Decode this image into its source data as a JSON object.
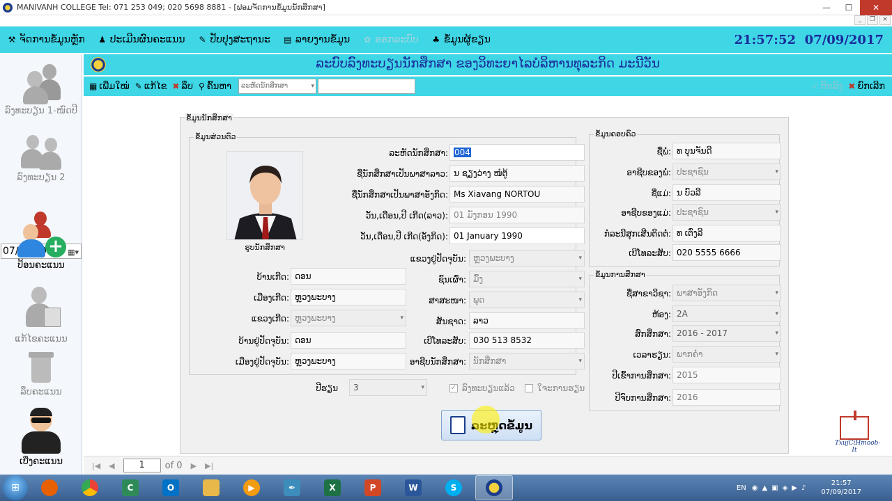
{
  "window": {
    "title": "MANIVANH COLLEGE Tel: 071 253 049; 020 5698 8881 - [ຟອມຈັດການຂໍ້ມູນນັກສຶກສາ]",
    "controls": {
      "minimize": "—",
      "maximize": "☐",
      "close": "✕"
    }
  },
  "menu": {
    "items": [
      {
        "label": "ຈັດການຂໍ້ມູນຫຼັກ",
        "icon": "wrench-icon",
        "glyph": "⚒"
      },
      {
        "label": "ປະເມີນຜົນຄະແນນ",
        "icon": "users-icon",
        "glyph": "♟"
      },
      {
        "label": "ປັບປຸງສະຖານະ",
        "icon": "edit-icon",
        "glyph": "✎"
      },
      {
        "label": "ລາຍງານຂໍ້ມູນ",
        "icon": "report-icon",
        "glyph": "▤"
      },
      {
        "label": "ອອກລະບົບ",
        "icon": "logout-icon",
        "glyph": "✿"
      },
      {
        "label": "ຂໍ້ມູນຜູ້ຂຽນ",
        "icon": "author-icon",
        "glyph": "♣"
      }
    ],
    "clock": "21:57:52",
    "date": "07/09/2017"
  },
  "sidebar": {
    "items": [
      {
        "label": "ລົງທະບຽນ 1-ໜົດປີ"
      },
      {
        "label": "ລົງທະບຽນ 2"
      },
      {
        "label": "ປ້ອນຄະແນນ"
      },
      {
        "label": "ແກ້ໄຂຄະແນນ"
      },
      {
        "label": "ລຶບຄະແນນ"
      },
      {
        "label": "ເບີ່ງຄະແນນ"
      }
    ],
    "date_value": "07/09/2017"
  },
  "header": {
    "title": "ລະບົບລົງທະບຽນນັກສຶກສາ ຂອງວິທະຍາໄລບໍລິຫານທຸລະກິດ ມະນີວັນ"
  },
  "toolbar": {
    "add": "ເພີ່ມໃໝ່",
    "edit": "ແກ້ໄຂ",
    "delete": "ລຶບ",
    "search": "ຄົ້ນຫາ",
    "search_select": "ລະຫັດນັກສຶກສາ",
    "confirm": "ຕົກລົງ",
    "cancel": "ຍົກເລີກ"
  },
  "form": {
    "main_legend": "ຂໍ້ມູນນັກສຶກສາ",
    "personal": {
      "legend": "ຂໍ້ມູນສ່ວນຕົວ",
      "photo_caption": "ຮູບນັກສຶກສາ",
      "student_id": {
        "label": "ລະຫັດນັກສຶກສາ:",
        "value": "004"
      },
      "name_lao": {
        "label": "ຊື່ນັກສຶກສາເປັນພາສາລາວ:",
        "value": "ນ ຊຽງວ່າງ ໜໍຕູ້"
      },
      "name_en": {
        "label": "ຊື່ນັກສຶກສາເປັນພາສາອັງກິດ:",
        "value": "Ms Xiavang NORTOU"
      },
      "dob_lao": {
        "label": "ວັນ,ເດືອນ,ປີ ເກີດ(ລາວ):",
        "value": "01 ມັງກອນ 1990"
      },
      "dob_en": {
        "label": "ວັນ,ເດືອນ,ປີ ເກີດ(ອັງກິດ):",
        "value": "01 January 1990"
      },
      "province_current": {
        "label": "ແຂວງຢູ່ປັດຈຸບັນ:",
        "value": "ຫຼວງພະບາງ"
      },
      "ethnicity": {
        "label": "ຊົນເຜົ່າ:",
        "value": "ມົ້ງ"
      },
      "religion": {
        "label": "ສາສະໜາ:",
        "value": "ພຸດ"
      },
      "nationality": {
        "label": "ສັນຊາດ:",
        "value": "ລາວ"
      },
      "phone": {
        "label": "ເບີໂທລະສັບ:",
        "value": "030 513 8532"
      },
      "occupation": {
        "label": "ອາຊີບນັກສຶກສາ:",
        "value": "ນັກສຶກສາ"
      },
      "birth_village": {
        "label": "ບ້ານເກີດ:",
        "value": "ດອນ"
      },
      "birth_district": {
        "label": "ເມືອງເກີດ:",
        "value": "ຫຼວງພະບາງ"
      },
      "birth_province": {
        "label": "ແຂວງເກີດ:",
        "value": "ຫຼວງພະບາງ"
      },
      "current_village": {
        "label": "ບ້ານຢູ່ປັດຈຸບັນ:",
        "value": "ດອນ"
      },
      "current_district": {
        "label": "ເມືອງຢູ່ປັດຈຸບັນ:",
        "value": "ຫຼວງພະບາງ"
      }
    },
    "year": {
      "label": "ປີຮຽນ",
      "value": "3"
    },
    "registered": {
      "label": "ລົງທະບຽນແລ້ວ",
      "checked": true
    },
    "scholarship": {
      "label": "ໃຈະການຮຽນ",
      "checked": false
    },
    "family": {
      "legend": "ຂໍ້ມູນຄອບຄົວ",
      "father_name": {
        "label": "ຊື່ພໍ່:",
        "value": "ທ ບຸນຈັນດີ"
      },
      "father_job": {
        "label": "ອາຊີບຂອງພໍ່:",
        "value": "ປະຊາຊົນ"
      },
      "mother_name": {
        "label": "ຊື່ແມ່:",
        "value": "ນ ບົວລີ"
      },
      "mother_job": {
        "label": "ອາຊີບຂອງແມ່:",
        "value": "ປະຊາຊົນ"
      },
      "guardian": {
        "label": "ກໍລະນີສຸກເສີນຕິດຕໍ່:",
        "value": "ທ ເຕົ່ງລີ"
      },
      "guardian_phone": {
        "label": "ເບີໂທລະສັບ:",
        "value": "020 5555 6666"
      }
    },
    "study": {
      "legend": "ຂໍ້ມູນການສຶກສາ",
      "major": {
        "label": "ຊື່ສາຂາວິຊາ:",
        "value": "ພາສາອັງກິດ"
      },
      "room": {
        "label": "ຫ້ອງ:",
        "value": "2A"
      },
      "academic_year": {
        "label": "ສົກສຶກສາ:",
        "value": "2016 - 2017"
      },
      "time": {
        "label": "ເວລາຮຽນ:",
        "value": "ພາກຄ່ຳ"
      },
      "start_year": {
        "label": "ປີເຂົ້າການສຶກສາ:",
        "value": "2015"
      },
      "end_year": {
        "label": "ປີຈົບການສຶກສາ:",
        "value": "2016"
      }
    },
    "save_button": "ລະຫຼຸດຂໍ້ມູນ"
  },
  "pager": {
    "page": "1",
    "of": "of 0"
  },
  "brand": {
    "caption": "TxujCiHmoob-It"
  },
  "taskbar": {
    "apps": [
      {
        "name": "firefox-icon",
        "color": "#e66000",
        "glyph": ""
      },
      {
        "name": "chrome-icon",
        "color": "#34a853",
        "glyph": ""
      },
      {
        "name": "camtasia-icon",
        "color": "#2e8b57",
        "glyph": "C"
      },
      {
        "name": "outlook-icon",
        "color": "#0072c6",
        "glyph": "O"
      },
      {
        "name": "explorer-icon",
        "color": "#e8b84a",
        "glyph": ""
      },
      {
        "name": "media-player-icon",
        "color": "#f39c12",
        "glyph": "▶"
      },
      {
        "name": "pen-icon",
        "color": "#3c8dbc",
        "glyph": "✒"
      },
      {
        "name": "excel-icon",
        "color": "#1e7145",
        "glyph": "X"
      },
      {
        "name": "powerpoint-icon",
        "color": "#d24726",
        "glyph": "P"
      },
      {
        "name": "word-icon",
        "color": "#2b579a",
        "glyph": "W"
      },
      {
        "name": "skype-icon",
        "color": "#00aff0",
        "glyph": "S"
      },
      {
        "name": "college-app-icon",
        "color": "#f4d03f",
        "glyph": ""
      }
    ],
    "lang": "EN",
    "time": "21:57",
    "date": "07/09/2017"
  }
}
